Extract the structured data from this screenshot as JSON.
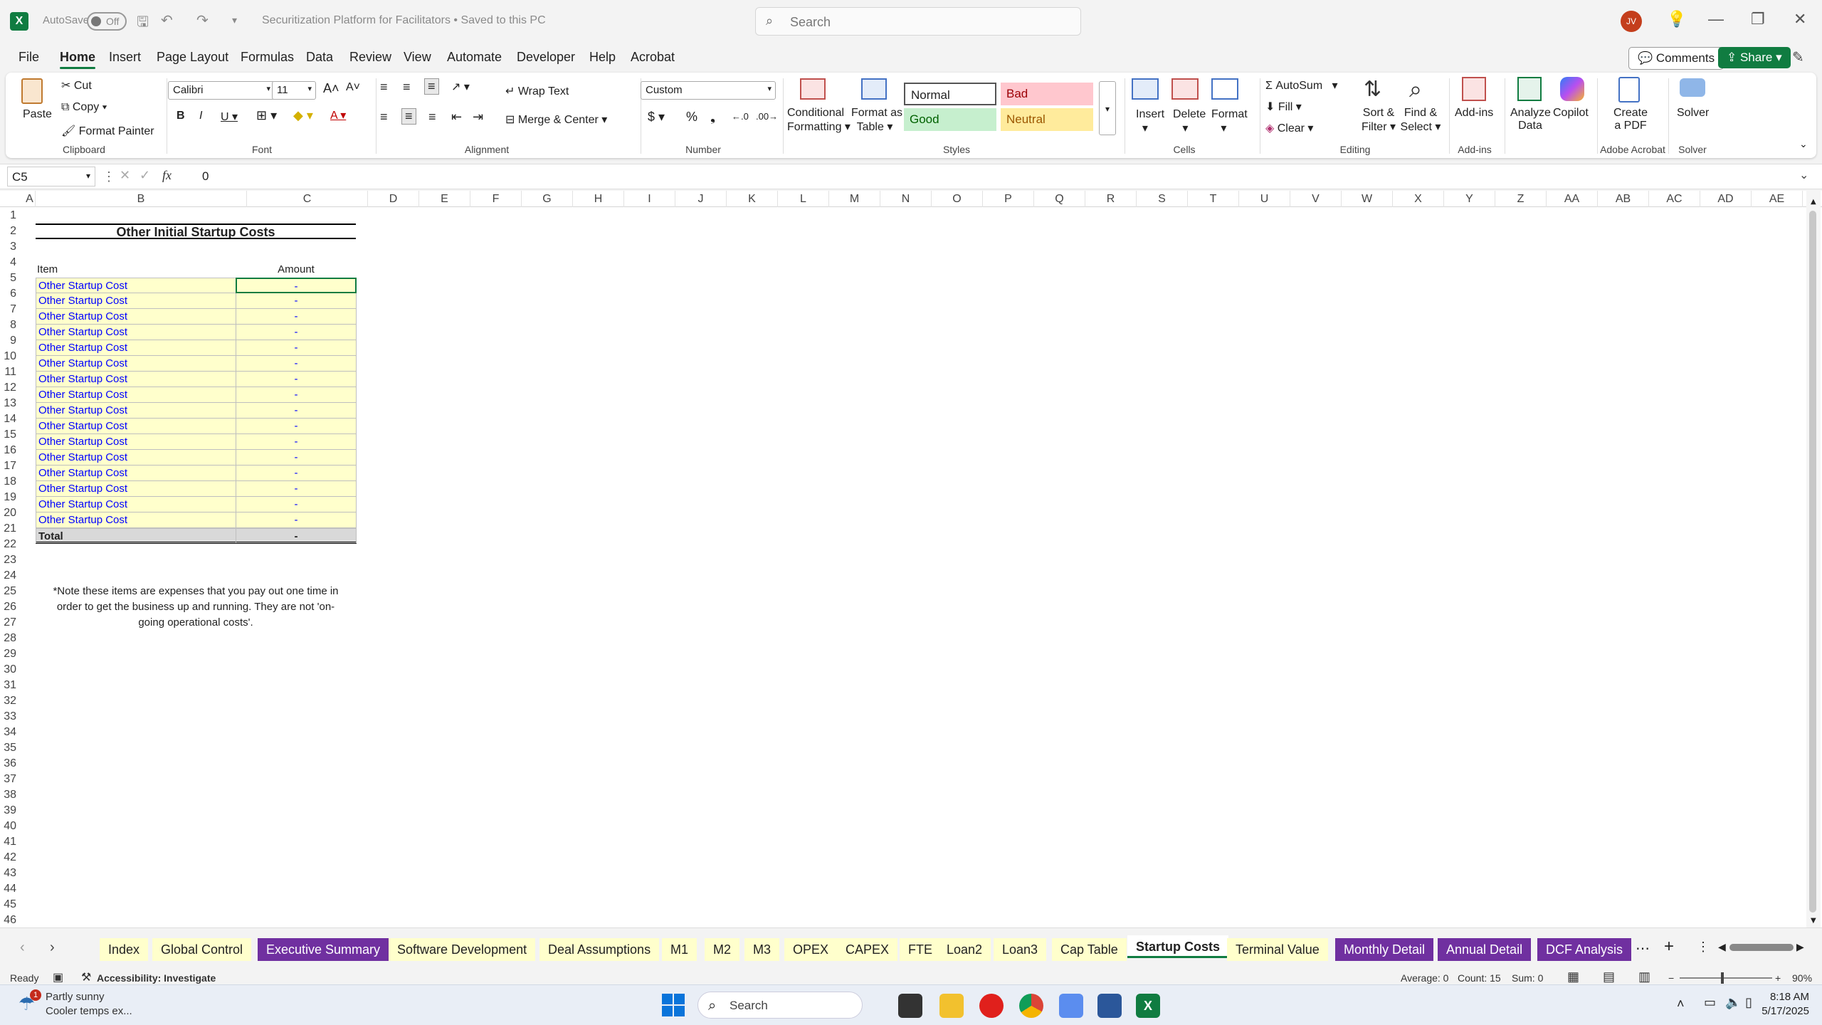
{
  "titlebar": {
    "autosave_label": "AutoSave",
    "autosave_state": "Off",
    "document_title": "Securitization Platform for Facilitators • Saved to this PC",
    "search_placeholder": "Search",
    "user_initials": "JV"
  },
  "menu_tabs": [
    "File",
    "Home",
    "Insert",
    "Page Layout",
    "Formulas",
    "Data",
    "Review",
    "View",
    "Automate",
    "Developer",
    "Help",
    "Acrobat"
  ],
  "active_tab": "Home",
  "actions": {
    "comments": "Comments",
    "share": "Share"
  },
  "ribbon": {
    "clipboard": {
      "paste": "Paste",
      "cut": "Cut",
      "copy": "Copy",
      "format_painter": "Format Painter",
      "group": "Clipboard"
    },
    "font": {
      "name": "Calibri",
      "size": "11",
      "group": "Font"
    },
    "alignment": {
      "wrap_text": "Wrap Text",
      "merge_center": "Merge & Center",
      "group": "Alignment"
    },
    "number": {
      "format": "Custom",
      "group": "Number"
    },
    "styles": {
      "conditional_1": "Conditional",
      "conditional_2": "Formatting",
      "format_table_1": "Format as",
      "format_table_2": "Table",
      "normal": "Normal",
      "bad": "Bad",
      "good": "Good",
      "neutral": "Neutral",
      "group": "Styles"
    },
    "cells": {
      "insert": "Insert",
      "delete": "Delete",
      "format": "Format",
      "group": "Cells"
    },
    "editing": {
      "autosum": "AutoSum",
      "fill": "Fill",
      "clear": "Clear",
      "sort_1": "Sort &",
      "sort_2": "Filter",
      "find_1": "Find &",
      "find_2": "Select",
      "group": "Editing"
    },
    "addins": {
      "addins": "Add-ins",
      "group": "Add-ins"
    },
    "analyze": {
      "l1": "Analyze",
      "l2": "Data"
    },
    "copilot": "Copilot",
    "acrobat": {
      "l1": "Create",
      "l2": "a PDF",
      "group": "Adobe Acrobat"
    },
    "solver": {
      "label": "Solver",
      "group": "Solver"
    }
  },
  "formula_bar": {
    "name_box": "C5",
    "fx": "fx",
    "value": "0"
  },
  "columns": [
    "A",
    "B",
    "C",
    "D",
    "E",
    "F",
    "G",
    "H",
    "I",
    "J",
    "K",
    "L",
    "M",
    "N",
    "O",
    "P",
    "Q",
    "R",
    "S",
    "T",
    "U",
    "V",
    "W",
    "X",
    "Y",
    "Z",
    "AA",
    "AB",
    "AC",
    "AD",
    "AE"
  ],
  "rows": [
    "1",
    "2",
    "3",
    "4",
    "5",
    "6",
    "7",
    "8",
    "9",
    "10",
    "11",
    "12",
    "13",
    "14",
    "15",
    "16",
    "17",
    "18",
    "19",
    "20",
    "21",
    "22",
    "23",
    "24",
    "25",
    "26",
    "27",
    "28",
    "29",
    "30",
    "31",
    "32",
    "33",
    "34",
    "35",
    "36",
    "37",
    "38",
    "39",
    "40",
    "41",
    "42",
    "43",
    "44",
    "45",
    "46"
  ],
  "sheet": {
    "title": "Other Initial Startup Costs",
    "header_item": "Item",
    "header_amount": "Amount",
    "items": [
      {
        "item": "Other Startup Cost",
        "amount": "-"
      },
      {
        "item": "Other Startup Cost",
        "amount": "-"
      },
      {
        "item": "Other Startup Cost",
        "amount": "-"
      },
      {
        "item": "Other Startup Cost",
        "amount": "-"
      },
      {
        "item": "Other Startup Cost",
        "amount": "-"
      },
      {
        "item": "Other Startup Cost",
        "amount": "-"
      },
      {
        "item": "Other Startup Cost",
        "amount": "-"
      },
      {
        "item": "Other Startup Cost",
        "amount": "-"
      },
      {
        "item": "Other Startup Cost",
        "amount": "-"
      },
      {
        "item": "Other Startup Cost",
        "amount": "-"
      },
      {
        "item": "Other Startup Cost",
        "amount": "-"
      },
      {
        "item": "Other Startup Cost",
        "amount": "-"
      },
      {
        "item": "Other Startup Cost",
        "amount": "-"
      },
      {
        "item": "Other Startup Cost",
        "amount": "-"
      },
      {
        "item": "Other Startup Cost",
        "amount": "-"
      },
      {
        "item": "Other Startup Cost",
        "amount": "-"
      }
    ],
    "total_label": "Total",
    "total_value": "-",
    "note_1": "*Note these items are expenses that you pay out one time in",
    "note_2": "order to get the business up and running. They are not 'on-",
    "note_3": "going operational costs'."
  },
  "sheet_tabs": [
    {
      "label": "Index",
      "style": "y"
    },
    {
      "label": "Global Control",
      "style": "y"
    },
    {
      "label": "Executive Summary",
      "style": "p"
    },
    {
      "label": "Software Development",
      "style": "y"
    },
    {
      "label": "Deal Assumptions",
      "style": "y"
    },
    {
      "label": "M1",
      "style": "y"
    },
    {
      "label": "M2",
      "style": "y"
    },
    {
      "label": "M3",
      "style": "y"
    },
    {
      "label": "OPEX",
      "style": "y"
    },
    {
      "label": "CAPEX",
      "style": "y"
    },
    {
      "label": "FTE",
      "style": "y"
    },
    {
      "label": "Loan2",
      "style": "y"
    },
    {
      "label": "Loan3",
      "style": "y"
    },
    {
      "label": "Cap Table",
      "style": "y"
    },
    {
      "label": "Startup Costs",
      "style": "act"
    },
    {
      "label": "Terminal Value",
      "style": "y"
    },
    {
      "label": "Monthly Detail",
      "style": "p"
    },
    {
      "label": "Annual Detail",
      "style": "p"
    },
    {
      "label": "DCF Analysis",
      "style": "p"
    }
  ],
  "status": {
    "ready": "Ready",
    "accessibility": "Accessibility: Investigate",
    "average": "Average: 0",
    "count": "Count: 15",
    "sum": "Sum: 0",
    "zoom": "90%"
  },
  "taskbar": {
    "weather_1": "Partly sunny",
    "weather_2": "Cooler temps ex...",
    "badge": "1",
    "search": "Search",
    "time": "8:18 AM",
    "date": "5/17/2025"
  },
  "colors": {
    "excel_green": "#107c41",
    "input_yellow": "#ffffcc",
    "tab_purple": "#7030a0",
    "link_blue": "#0000ff"
  }
}
